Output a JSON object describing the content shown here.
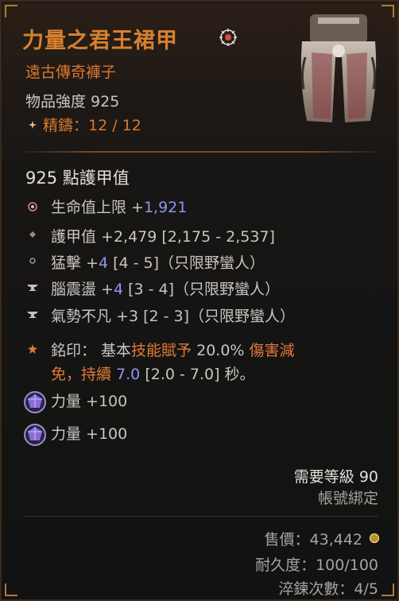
{
  "item": {
    "name": "力量之君王裙甲",
    "type": "遠古傳奇褲子",
    "item_power": "物品強度 925",
    "masterwork": "精鑄：12 / 12",
    "armor": "925 點護甲值",
    "name_color": "#d8812f",
    "rarity_color": "#d8782f"
  },
  "affixes": [
    {
      "label": "生命值上限 +",
      "value": "1,921",
      "range": "",
      "icon": "flower-icon"
    },
    {
      "label": "護甲值 +2,479 [2,175 - 2,537]",
      "value": "",
      "range": "",
      "icon": "diamond-icon"
    },
    {
      "label": "猛擊 +",
      "value": "4",
      "range": " [4 - 5]（只限野蠻人）",
      "icon": "circle-icon"
    },
    {
      "label": "腦震盪 +",
      "value": "4",
      "range": " [3 - 4]（只限野蠻人）",
      "icon": "anvil-icon"
    },
    {
      "label": "氣勢不凡 +3 [2 - 3]（只限野蠻人）",
      "value": "",
      "range": "",
      "icon": "anvil-icon"
    }
  ],
  "aspect": {
    "line1_a": "銘印： 基本",
    "line1_b": "技能賦予",
    "line1_c": " 20.0% ",
    "line1_d": "傷害減",
    "line2_a": "免，持續",
    "line2_b": " 7.0",
    "line2_c": " [2.0 - 7.0] 秒。",
    "icon": "star-icon"
  },
  "gems": [
    {
      "label": "力量 +100",
      "icon": "amethyst-icon"
    },
    {
      "label": "力量 +100",
      "icon": "amethyst-icon"
    }
  ],
  "requirements": {
    "level": "需要等級 90",
    "binding": "帳號綁定"
  },
  "footer": {
    "sell_value": "售價：43,442",
    "durability": "耐久度：100/100",
    "temper_count": "淬鍊次數：4/5",
    "gold_icon": "gold-coin-icon"
  }
}
